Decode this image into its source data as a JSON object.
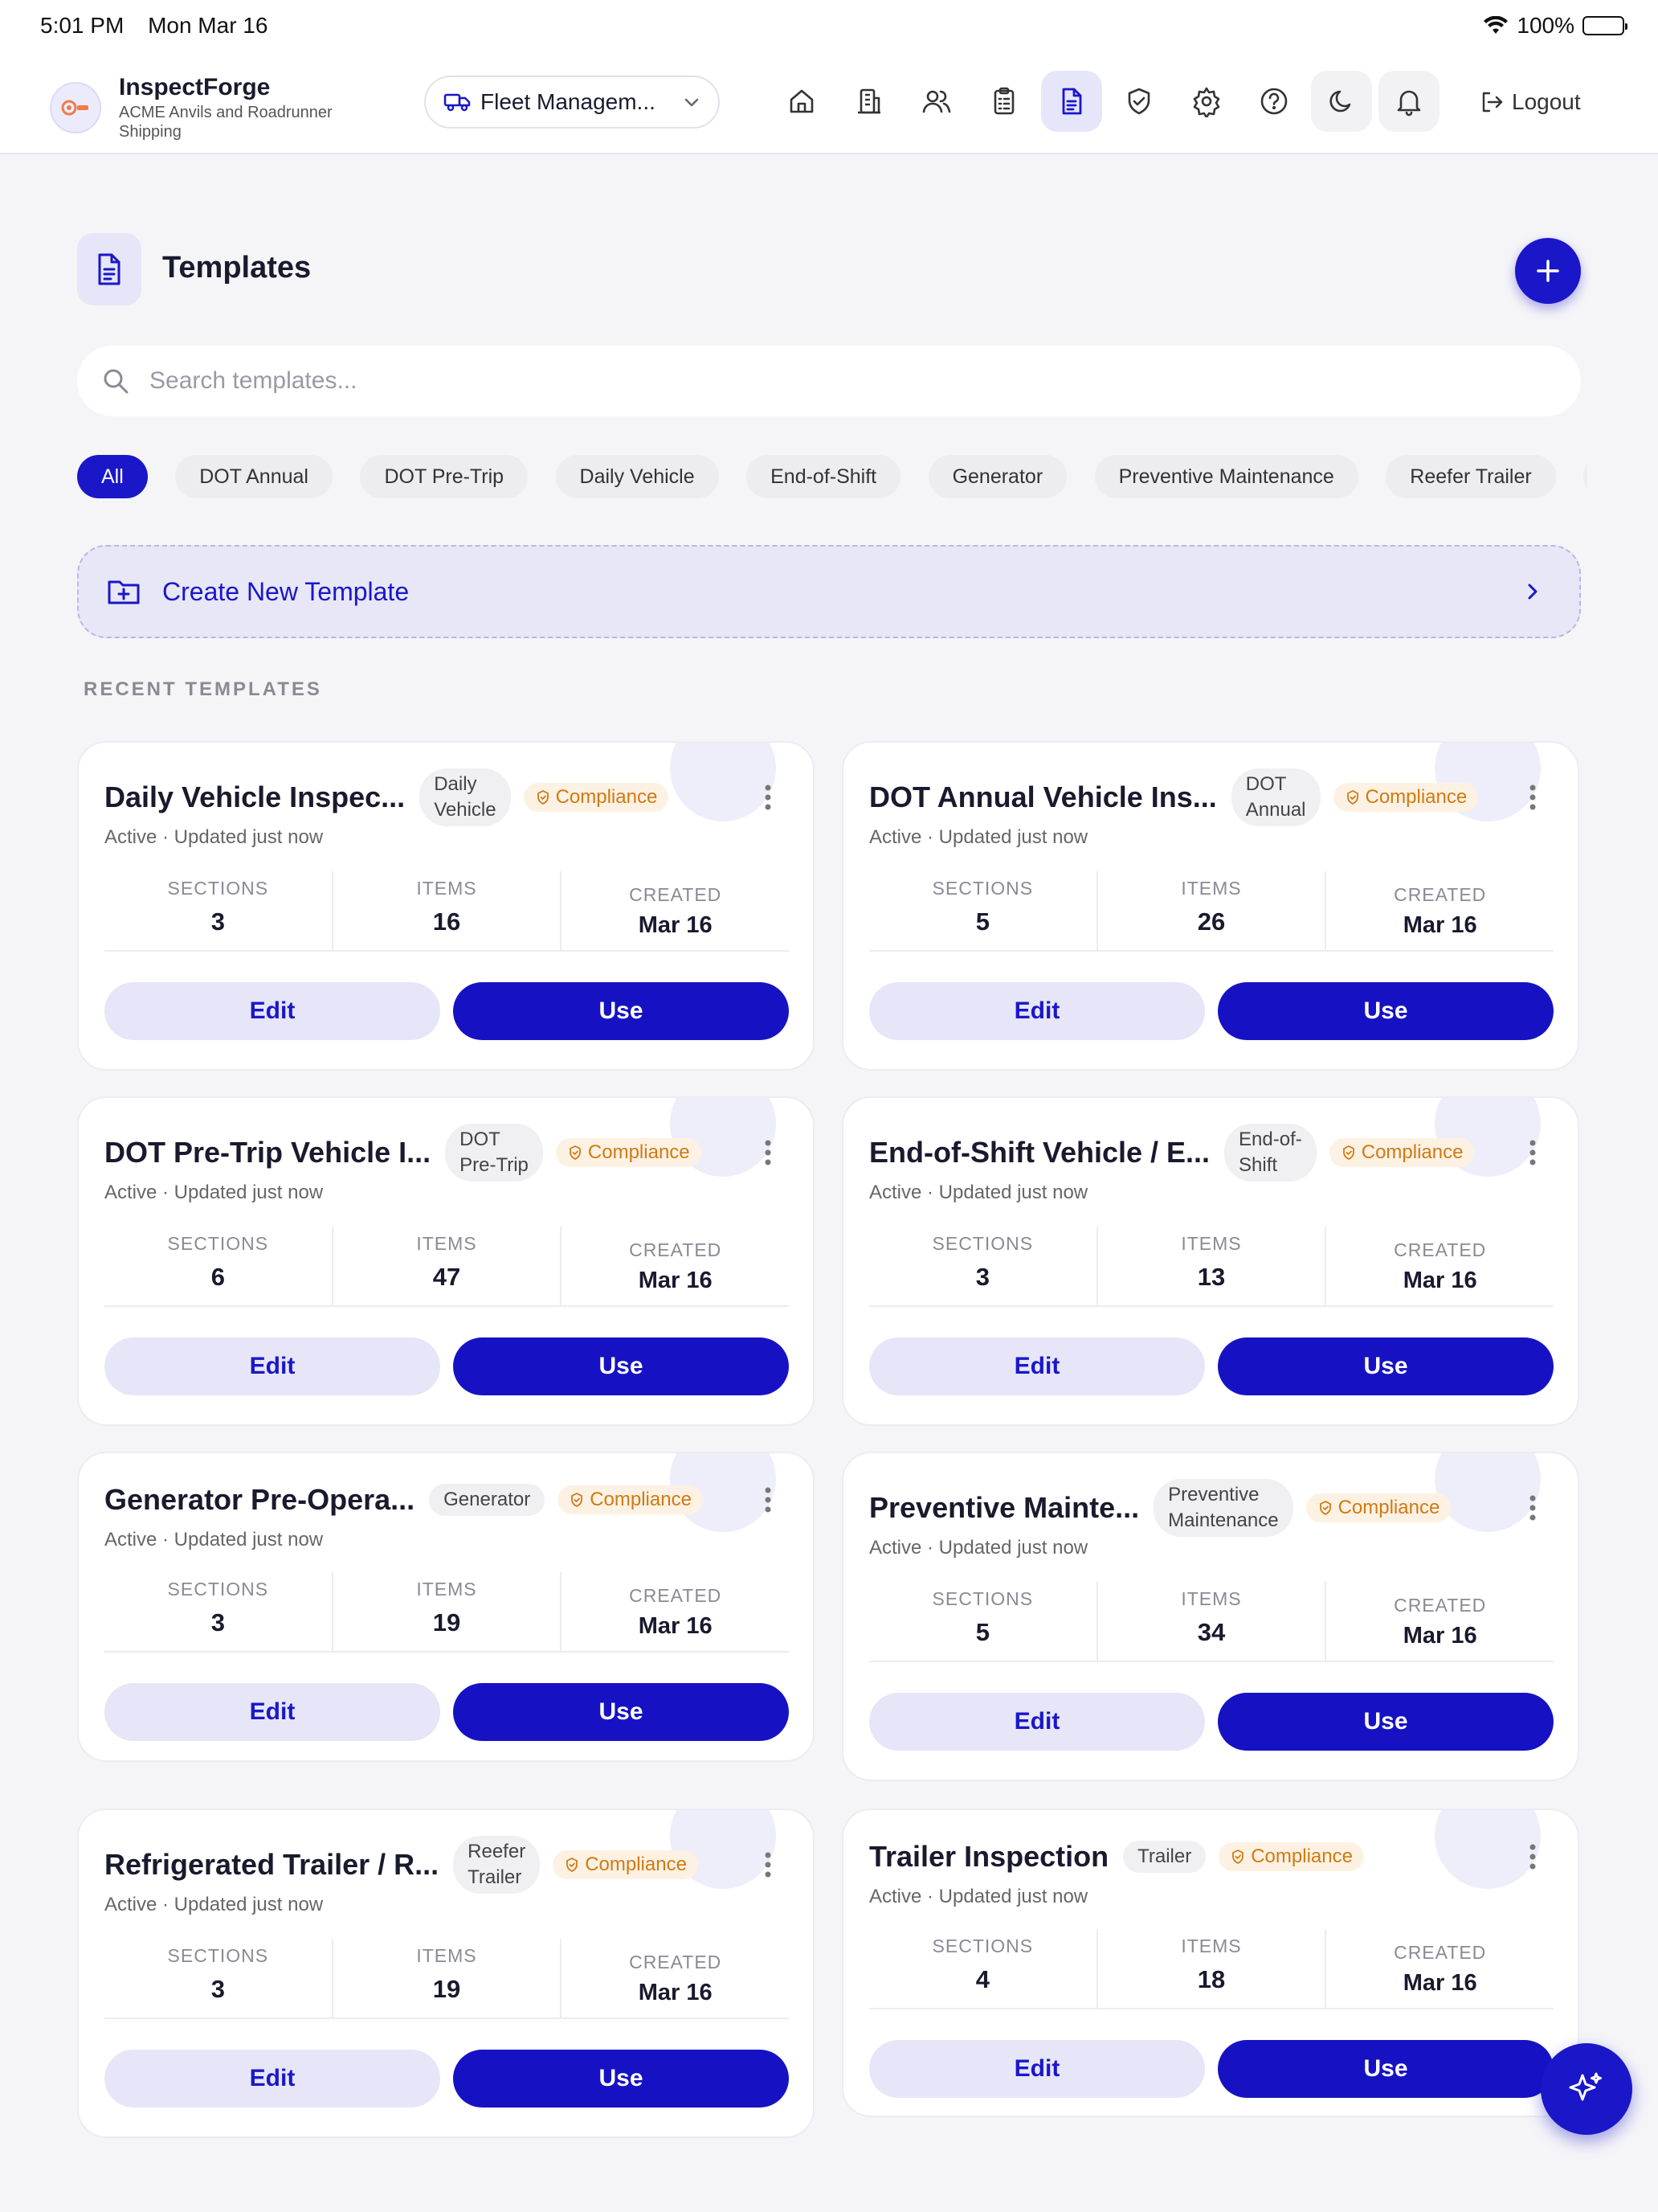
{
  "status_bar": {
    "time": "5:01 PM",
    "date": "Mon Mar 16",
    "battery": "100%"
  },
  "header": {
    "app_name": "InspectForge",
    "org_name": "ACME Anvils and Roadrunner Shipping",
    "org_select": "Fleet Managem...",
    "logout_label": "Logout",
    "nav_icons": [
      "home-icon",
      "building-icon",
      "users-icon",
      "clipboard-icon",
      "document-icon",
      "shield-icon",
      "gear-icon",
      "help-icon",
      "moon-icon",
      "bell-icon"
    ],
    "active_nav": "document-icon"
  },
  "page": {
    "title": "Templates",
    "search_placeholder": "Search templates...",
    "filters": [
      "All",
      "DOT Annual",
      "DOT Pre-Trip",
      "Daily Vehicle",
      "End-of-Shift",
      "Generator",
      "Preventive Maintenance",
      "Reefer Trailer",
      "T"
    ],
    "active_filter": "All",
    "create_new_label": "Create New Template",
    "section_label": "RECENT TEMPLATES"
  },
  "stat_labels": {
    "sections": "SECTIONS",
    "items": "ITEMS",
    "created": "CREATED"
  },
  "action_labels": {
    "edit": "Edit",
    "use": "Use"
  },
  "compliance_label": "Compliance",
  "templates": [
    {
      "title": "Daily Vehicle Inspec...",
      "tag": "Daily\nVehicle",
      "subtitle": "Active · Updated just now",
      "sections": "3",
      "items": "16",
      "created": "Mar 16"
    },
    {
      "title": "DOT Annual Vehicle Ins...",
      "tag": "DOT\nAnnual",
      "subtitle": "Active · Updated just now",
      "sections": "5",
      "items": "26",
      "created": "Mar 16"
    },
    {
      "title": "DOT Pre-Trip Vehicle I...",
      "tag": "DOT\nPre-Trip",
      "subtitle": "Active · Updated just now",
      "sections": "6",
      "items": "47",
      "created": "Mar 16"
    },
    {
      "title": "End-of-Shift Vehicle / E...",
      "tag": "End-of-\nShift",
      "subtitle": "Active · Updated just now",
      "sections": "3",
      "items": "13",
      "created": "Mar 16"
    },
    {
      "title": "Generator Pre-Opera...",
      "tag": "Generator",
      "subtitle": "Active · Updated just now",
      "sections": "3",
      "items": "19",
      "created": "Mar 16"
    },
    {
      "title": "Preventive Mainte...",
      "tag": "Preventive\nMaintenance",
      "subtitle": "Active · Updated just now",
      "sections": "5",
      "items": "34",
      "created": "Mar 16"
    },
    {
      "title": "Refrigerated Trailer / R...",
      "tag": "Reefer\nTrailer",
      "subtitle": "Active · Updated just now",
      "sections": "3",
      "items": "19",
      "created": "Mar 16"
    },
    {
      "title": "Trailer Inspection",
      "tag": "Trailer",
      "subtitle": "Active · Updated just now",
      "sections": "4",
      "items": "18",
      "created": "Mar 16"
    }
  ],
  "colors": {
    "accent": "#1a17c9",
    "accent_soft": "#e6e6f8",
    "compliance": "#d07a12",
    "background": "#f5f5f8"
  }
}
